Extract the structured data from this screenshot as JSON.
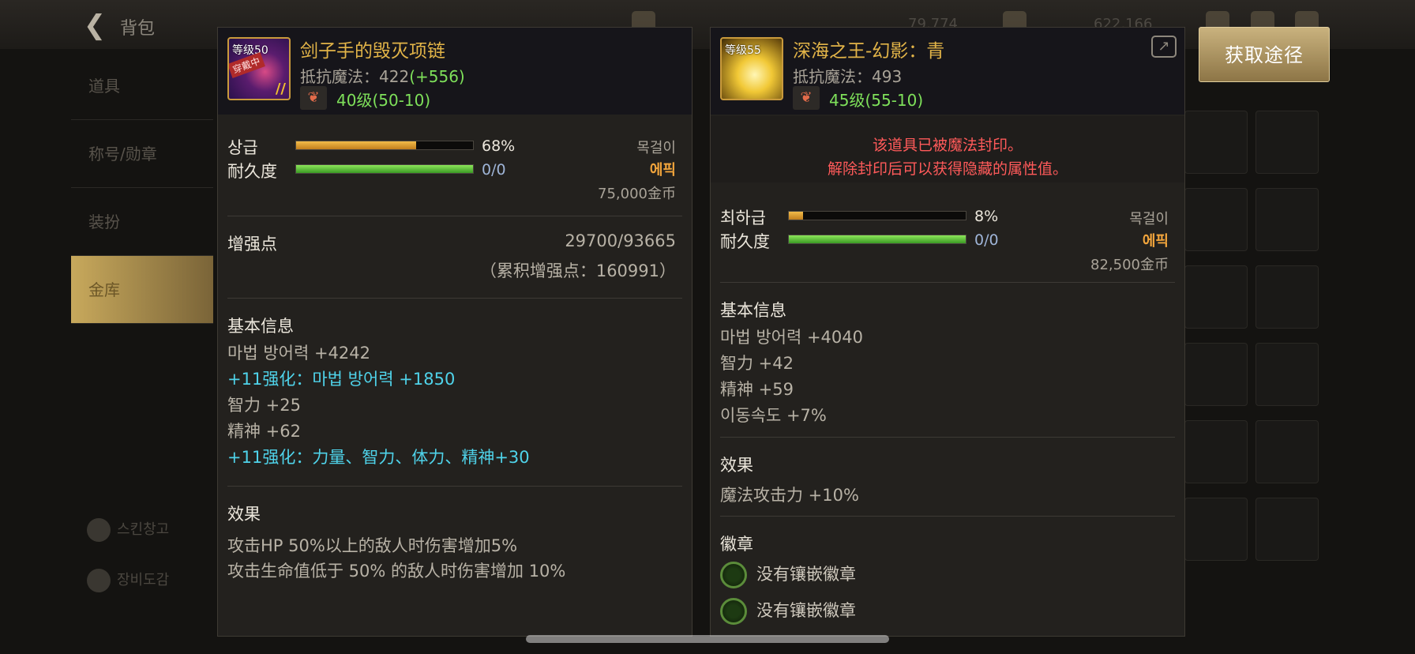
{
  "background": {
    "bag_title": "背包",
    "top_values": [
      "79,774",
      "622,166"
    ],
    "sidebar": [
      "道具",
      "称号/勋章",
      "装扮",
      "金库"
    ],
    "sidebar_bottom": [
      "스킨창고",
      "장비도감"
    ]
  },
  "acquire_button": "获取途径",
  "left_item": {
    "icon_level": "等级50",
    "icon_badge": "穿戴中",
    "name": "剑子手的毁灭项链",
    "magic_res_label": "抵抗魔法：422",
    "magic_res_bonus": "(+556)",
    "level_text": "40级(50-10)",
    "grade_label": "상급",
    "grade_pct_value": 0.68,
    "grade_pct": "68%",
    "durability_label": "耐久度",
    "durability_fill": 1.0,
    "durability": "0/0",
    "slot_type": "목걸이",
    "rarity": "에픽",
    "price": "75,000金币",
    "enhance_label": "增强点",
    "enhance_value": "29700/93665",
    "enhance_total": "（累积增强点：160991）",
    "basic_title": "基本信息",
    "basic_lines": [
      {
        "text": "마법 방어력 +4242",
        "cyan": false
      },
      {
        "text": "+11强化：마법 방어력 +1850",
        "cyan": true
      },
      {
        "text": "智力 +25",
        "cyan": false
      },
      {
        "text": "精神 +62",
        "cyan": false
      },
      {
        "text": "+11强化：力量、智力、体力、精神+30",
        "cyan": true
      }
    ],
    "effect_title": "效果",
    "effect_lines": [
      "攻击HP 50%以上的敌人时伤害增加5%",
      "攻击生命值低于 50% 的敌人时伤害增加 10%"
    ]
  },
  "right_item": {
    "icon_level": "等级55",
    "name": "深海之王-幻影：青",
    "magic_res_label": "抵抗魔法：493",
    "level_text": "45级(55-10)",
    "seal_line1": "该道具已被魔法封印。",
    "seal_line2": "解除封印后可以获得隐藏的属性值。",
    "grade_label": "최하급",
    "grade_pct_value": 0.08,
    "grade_pct": "8%",
    "durability_label": "耐久度",
    "durability_fill": 1.0,
    "durability": "0/0",
    "slot_type": "목걸이",
    "rarity": "에픽",
    "price": "82,500金币",
    "basic_title": "基本信息",
    "basic_lines": [
      "마법 방어력 +4040",
      "智力 +42",
      "精神 +59",
      "이동속도 +7%"
    ],
    "effect_title": "效果",
    "effect_lines": [
      "魔法攻击力 +10%"
    ],
    "emblem_title": "徽章",
    "emblem_slots": [
      "没有镶嵌徽章",
      "没有镶嵌徽章"
    ]
  }
}
